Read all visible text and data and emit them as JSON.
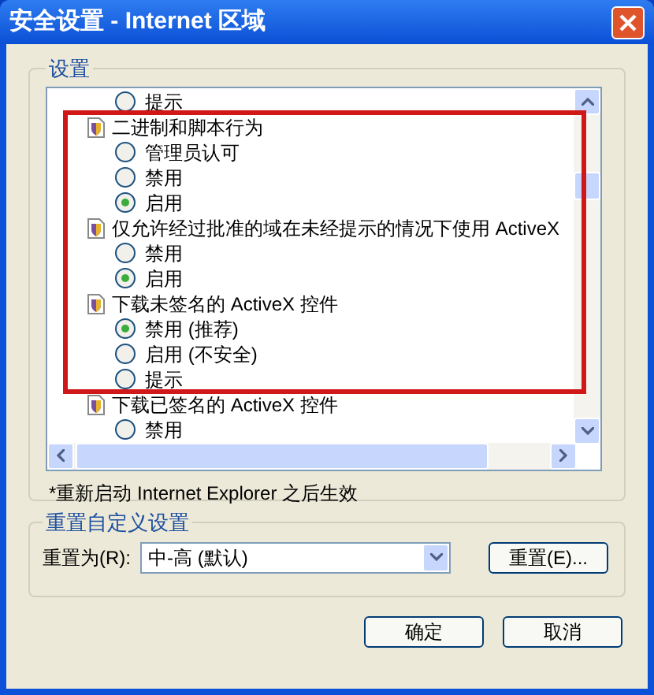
{
  "window": {
    "title": "安全设置 - Internet 区域"
  },
  "settings_group": {
    "title": "设置",
    "items": [
      {
        "kind": "option",
        "label": "提示",
        "selected": false
      },
      {
        "kind": "category",
        "label": "二进制和脚本行为",
        "children": [
          {
            "kind": "option",
            "label": "管理员认可",
            "selected": false
          },
          {
            "kind": "option",
            "label": "禁用",
            "selected": false
          },
          {
            "kind": "option",
            "label": "启用",
            "selected": true
          }
        ]
      },
      {
        "kind": "category",
        "label": "仅允许经过批准的域在未经提示的情况下使用 ActiveX",
        "children": [
          {
            "kind": "option",
            "label": "禁用",
            "selected": false
          },
          {
            "kind": "option",
            "label": "启用",
            "selected": true
          }
        ]
      },
      {
        "kind": "category",
        "label": "下载未签名的 ActiveX 控件",
        "children": [
          {
            "kind": "option",
            "label": "禁用 (推荐)",
            "selected": true
          },
          {
            "kind": "option",
            "label": "启用 (不安全)",
            "selected": false
          },
          {
            "kind": "option",
            "label": "提示",
            "selected": false
          }
        ]
      },
      {
        "kind": "category",
        "label": "下载已签名的 ActiveX 控件",
        "children": [
          {
            "kind": "option",
            "label": "禁用",
            "selected": false
          }
        ]
      }
    ],
    "note": "*重新启动 Internet Explorer 之后生效"
  },
  "annotation": {
    "kind": "frame",
    "color": "#d01818"
  },
  "reset_group": {
    "title": "重置自定义设置",
    "label": "重置为(R):",
    "value": "中-高 (默认)",
    "button": "重置(E)..."
  },
  "buttons": [
    "确定",
    "取消"
  ]
}
